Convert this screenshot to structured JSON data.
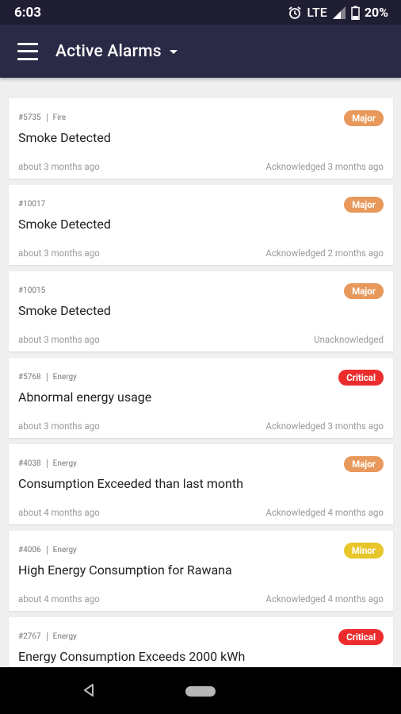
{
  "status_bar": {
    "time": "6:03",
    "network": "LTE",
    "battery": "20%"
  },
  "app_bar": {
    "title": "Active Alarms"
  },
  "colors": {
    "major": "#e8985a",
    "critical": "#ec2c2c",
    "minor": "#e8c62a"
  },
  "alarms": [
    {
      "id": "#5735",
      "category": "Fire",
      "title": "Smoke Detected",
      "time": "about 3 months ago",
      "status": "Acknowledged 3 months ago",
      "severity": "Major",
      "severity_key": "major"
    },
    {
      "id": "#10017",
      "category": "",
      "title": "Smoke Detected",
      "time": "about 3 months ago",
      "status": "Acknowledged 2 months ago",
      "severity": "Major",
      "severity_key": "major"
    },
    {
      "id": "#10015",
      "category": "",
      "title": "Smoke Detected",
      "time": "about 3 months ago",
      "status": "Unacknowledged",
      "severity": "Major",
      "severity_key": "major"
    },
    {
      "id": "#5768",
      "category": "Energy",
      "title": "Abnormal energy usage",
      "time": "about 3 months ago",
      "status": "Acknowledged 3 months ago",
      "severity": "Critical",
      "severity_key": "critical"
    },
    {
      "id": "#4038",
      "category": "Energy",
      "title": "Consumption Exceeded than last month",
      "time": "about 4 months ago",
      "status": "Acknowledged 4 months ago",
      "severity": "Major",
      "severity_key": "major"
    },
    {
      "id": "#4006",
      "category": "Energy",
      "title": "High Energy Consumption for Rawana",
      "time": "about 4 months ago",
      "status": "Acknowledged 4 months ago",
      "severity": "Minor",
      "severity_key": "minor"
    },
    {
      "id": "#2767",
      "category": "Energy",
      "title": "Energy Consumption Exceeds 2000 kWh",
      "time": "",
      "status": "",
      "severity": "Critical",
      "severity_key": "critical"
    }
  ]
}
